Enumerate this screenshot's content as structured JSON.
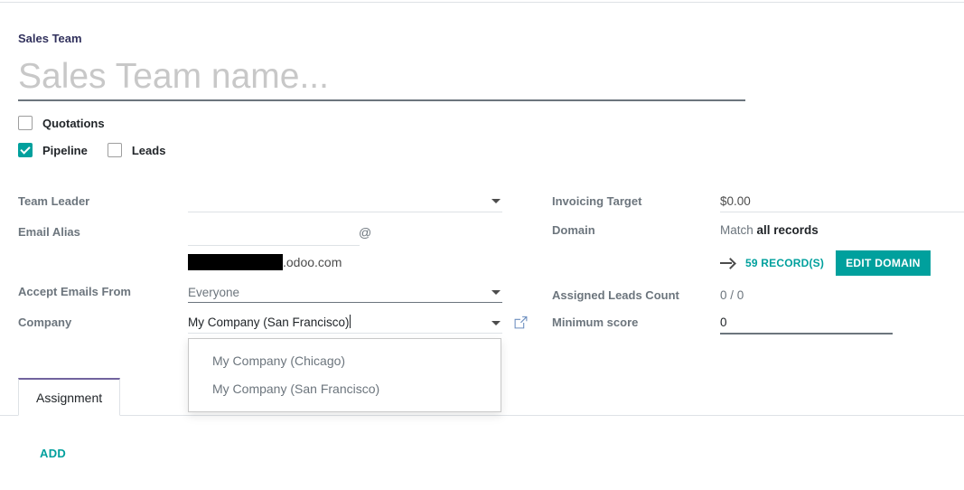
{
  "header": {
    "record_label": "Sales Team",
    "name_placeholder": "Sales Team name...",
    "name_value": ""
  },
  "feature_checkboxes": [
    {
      "label": "Quotations",
      "checked": false
    },
    {
      "label": "Pipeline",
      "checked": true
    },
    {
      "label": "Leads",
      "checked": false
    }
  ],
  "form": {
    "left": {
      "team_leader": {
        "label": "Team Leader",
        "value": ""
      },
      "email_alias": {
        "label": "Email Alias",
        "value": "",
        "at_sign": "@",
        "alias_domain_redacted": true,
        "alias_suffix": ".odoo.com"
      },
      "accept_emails_from": {
        "label": "Accept Emails From",
        "value": "Everyone"
      },
      "company": {
        "label": "Company",
        "value": "My Company (San Francisco)",
        "external_link_icon": "external-link-icon"
      }
    },
    "right": {
      "invoicing_target": {
        "label": "Invoicing Target",
        "value": "$0.00"
      },
      "domain": {
        "label": "Domain",
        "prefix": "Match ",
        "emphasis": "all records",
        "arrow_icon": "arrow-right-icon",
        "records_link": "59 RECORD(S)",
        "edit_button": "EDIT DOMAIN"
      },
      "assigned_leads_count": {
        "label": "Assigned Leads Count",
        "value": "0 / 0"
      },
      "minimum_score": {
        "label": "Minimum score",
        "value": "0"
      }
    }
  },
  "company_dropdown": {
    "visible": true,
    "options": [
      "My Company (Chicago)",
      "My Company (San Francisco)"
    ]
  },
  "notebook": {
    "tabs": [
      {
        "label": "Assignment",
        "active": true
      }
    ],
    "add_link": "ADD"
  },
  "colors": {
    "accent_teal": "#00a09d",
    "tab_active_border": "#71639e",
    "label_gray": "#6c757d",
    "text_dark": "#212529",
    "rule_gray": "#dee2e6",
    "redaction_black": "#000000"
  }
}
